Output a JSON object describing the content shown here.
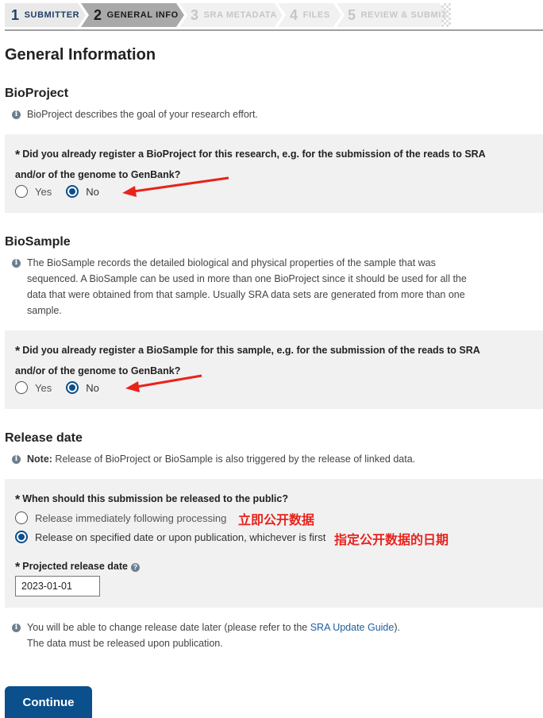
{
  "steps": [
    {
      "num": "1",
      "label": "SUBMITTER",
      "state": "done"
    },
    {
      "num": "2",
      "label": "GENERAL INFO",
      "state": "active"
    },
    {
      "num": "3",
      "label": "SRA METADATA",
      "state": "todo"
    },
    {
      "num": "4",
      "label": "FILES",
      "state": "todo"
    },
    {
      "num": "5",
      "label": "REVIEW & SUBMIT",
      "state": "todo"
    }
  ],
  "page_title": "General Information",
  "bioproject": {
    "heading": "BioProject",
    "info": "BioProject describes the goal of your research effort.",
    "question_line1": "Did you already register a BioProject for this research, e.g. for the submission of the reads to SRA",
    "question_line2": "and/or of the genome to GenBank?",
    "options": [
      "Yes",
      "No"
    ],
    "selected": "No"
  },
  "biosample": {
    "heading": "BioSample",
    "info_lines": [
      "The BioSample records the detailed biological and physical properties of the sample that was",
      "sequenced. A BioSample can be used in more than one BioProject since it should be used for all the",
      "data that were obtained from that sample. Usually SRA data sets are generated from more than one",
      "sample."
    ],
    "question_line1": "Did you already register a BioSample for this sample, e.g. for the submission of the reads to SRA",
    "question_line2": "and/or of the genome to GenBank?",
    "options": [
      "Yes",
      "No"
    ],
    "selected": "No"
  },
  "release": {
    "heading": "Release date",
    "note_label": "Note:",
    "note_text": " Release of BioProject or BioSample is also triggered by the release of linked data.",
    "question": "When should this submission be released to the public?",
    "option_immediate": "Release immediately following processing",
    "option_specified": "Release on specified date or upon publication, whichever is first",
    "selected": "specified",
    "annotation_immediate": "立即公开数据",
    "annotation_specified": "指定公开数据的日期",
    "date_label": "Projected release date",
    "date_value": "2023-01-01",
    "footer_line1_pre": "You will be able to change release date later (please refer to the ",
    "footer_link": "SRA Update Guide",
    "footer_line1_post": ").",
    "footer_line2": "The data must be released upon publication."
  },
  "continue_label": "Continue",
  "colors": {
    "accent": "#0b4f8c",
    "annotation": "#e8231c",
    "panel": "#f1f1f1"
  },
  "icons": {
    "info": "info-icon",
    "help": "question-circle-icon"
  }
}
